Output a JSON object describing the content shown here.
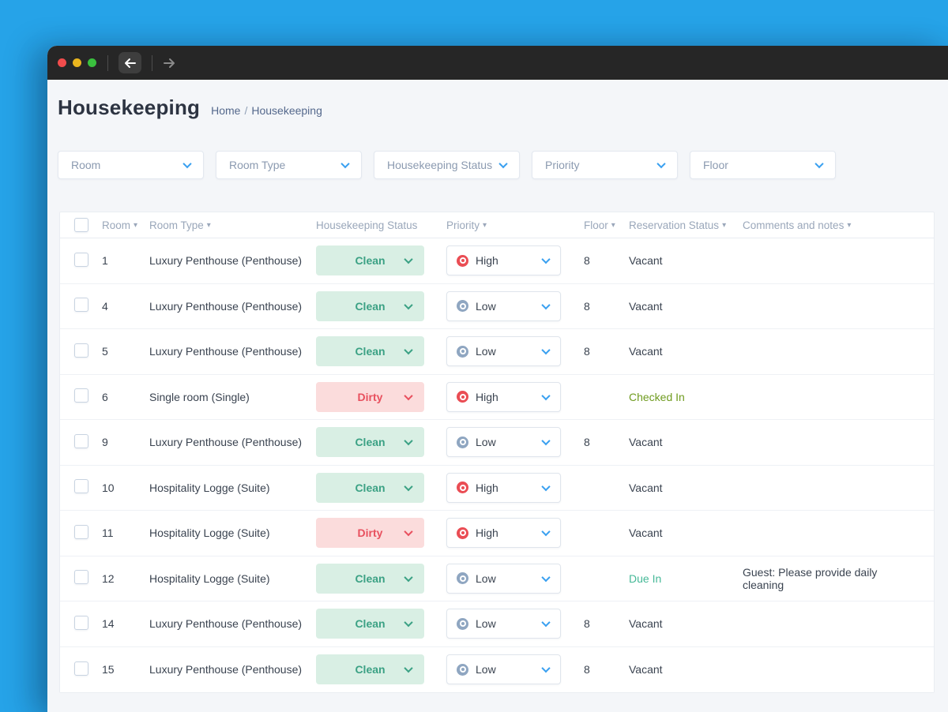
{
  "window": {
    "titlebar": {
      "close": "close",
      "minimize": "minimize",
      "maximize": "maximize",
      "back": "back-arrow",
      "forward": "forward-arrow"
    }
  },
  "page": {
    "title": "Housekeeping",
    "breadcrumb": {
      "home": "Home",
      "separator": "/",
      "current": "Housekeeping"
    }
  },
  "filters": [
    {
      "placeholder": "Room"
    },
    {
      "placeholder": "Room Type"
    },
    {
      "placeholder": "Housekeeping Status"
    },
    {
      "placeholder": "Priority"
    },
    {
      "placeholder": "Floor"
    }
  ],
  "table": {
    "headers": [
      {
        "label": "Room",
        "sortable": true
      },
      {
        "label": "Room Type",
        "sortable": true
      },
      {
        "label": "Housekeeping Status",
        "sortable": false
      },
      {
        "label": "Priority",
        "sortable": true
      },
      {
        "label": "Floor",
        "sortable": true
      },
      {
        "label": "Reservation Status",
        "sortable": true
      },
      {
        "label": "Comments and notes",
        "sortable": true
      }
    ],
    "rows": [
      {
        "room": "1",
        "room_type": "Luxury Penthouse (Penthouse)",
        "status": "Clean",
        "priority": "High",
        "floor": "8",
        "reservation": "Vacant",
        "comment": ""
      },
      {
        "room": "4",
        "room_type": "Luxury Penthouse (Penthouse)",
        "status": "Clean",
        "priority": "Low",
        "floor": "8",
        "reservation": "Vacant",
        "comment": ""
      },
      {
        "room": "5",
        "room_type": "Luxury Penthouse (Penthouse)",
        "status": "Clean",
        "priority": "Low",
        "floor": "8",
        "reservation": "Vacant",
        "comment": ""
      },
      {
        "room": "6",
        "room_type": "Single room (Single)",
        "status": "Dirty",
        "priority": "High",
        "floor": "",
        "reservation": "Checked In",
        "comment": ""
      },
      {
        "room": "9",
        "room_type": "Luxury Penthouse (Penthouse)",
        "status": "Clean",
        "priority": "Low",
        "floor": "8",
        "reservation": "Vacant",
        "comment": ""
      },
      {
        "room": "10",
        "room_type": "Hospitality Logge (Suite)",
        "status": "Clean",
        "priority": "High",
        "floor": "",
        "reservation": "Vacant",
        "comment": ""
      },
      {
        "room": "11",
        "room_type": "Hospitality Logge (Suite)",
        "status": "Dirty",
        "priority": "High",
        "floor": "",
        "reservation": "Vacant",
        "comment": ""
      },
      {
        "room": "12",
        "room_type": "Hospitality Logge (Suite)",
        "status": "Clean",
        "priority": "Low",
        "floor": "",
        "reservation": "Due In",
        "comment": "Guest: Please provide daily cleaning"
      },
      {
        "room": "14",
        "room_type": "Luxury Penthouse (Penthouse)",
        "status": "Clean",
        "priority": "Low",
        "floor": "8",
        "reservation": "Vacant",
        "comment": ""
      },
      {
        "room": "15",
        "room_type": "Luxury Penthouse (Penthouse)",
        "status": "Clean",
        "priority": "Low",
        "floor": "8",
        "reservation": "Vacant",
        "comment": ""
      }
    ]
  },
  "colors": {
    "background_blue": "#26a3e8",
    "titlebar": "#262626",
    "traffic_red": "#f14c4c",
    "traffic_yellow": "#e9b51e",
    "traffic_green": "#3ac03e",
    "clean_bg": "#d9efe4",
    "clean_text": "#3ba184",
    "dirty_bg": "#fbdcdc",
    "dirty_text": "#e8505e",
    "priority_high": "#ea4d54",
    "priority_low": "#8fa6c1",
    "checked_in_text": "#6f9b1f",
    "due_in_text": "#45b897",
    "accent_blue": "#3aa0f0"
  },
  "icons": {
    "chevron_down": "chevron-down-icon",
    "sort_caret": "sort-caret-icon",
    "priority_dot": "priority-dot-icon"
  }
}
